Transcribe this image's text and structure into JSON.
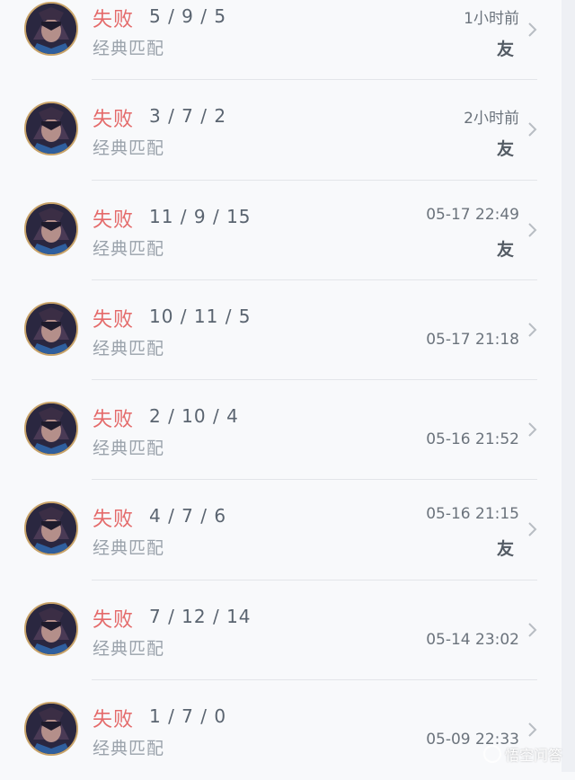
{
  "colors": {
    "loss": "#e46a6a",
    "kda": "#5a6470",
    "mode": "#9aa2ab",
    "time": "#6b737c",
    "friend": "#545c65",
    "avatar_border": "#c9a46a"
  },
  "matches": [
    {
      "result": "失败",
      "kda": "5 / 9 / 5",
      "mode": "经典匹配",
      "time": "1小时前",
      "friend": "友",
      "avatar_icon": "hero-avatar-icon",
      "chevron_icon": "chevron-right-icon"
    },
    {
      "result": "失败",
      "kda": "3 / 7 / 2",
      "mode": "经典匹配",
      "time": "2小时前",
      "friend": "友",
      "avatar_icon": "hero-avatar-icon",
      "chevron_icon": "chevron-right-icon"
    },
    {
      "result": "失败",
      "kda": "11 / 9 / 15",
      "mode": "经典匹配",
      "time": "05-17 22:49",
      "friend": "友",
      "avatar_icon": "hero-avatar-icon",
      "chevron_icon": "chevron-right-icon"
    },
    {
      "result": "失败",
      "kda": "10 / 11 / 5",
      "mode": "经典匹配",
      "time": "05-17 21:18",
      "friend": null,
      "avatar_icon": "hero-avatar-icon",
      "chevron_icon": "chevron-right-icon"
    },
    {
      "result": "失败",
      "kda": "2 / 10 / 4",
      "mode": "经典匹配",
      "time": "05-16 21:52",
      "friend": null,
      "avatar_icon": "hero-avatar-icon",
      "chevron_icon": "chevron-right-icon"
    },
    {
      "result": "失败",
      "kda": "4 / 7 / 6",
      "mode": "经典匹配",
      "time": "05-16 21:15",
      "friend": "友",
      "avatar_icon": "hero-avatar-icon",
      "chevron_icon": "chevron-right-icon"
    },
    {
      "result": "失败",
      "kda": "7 / 12 / 14",
      "mode": "经典匹配",
      "time": "05-14 23:02",
      "friend": null,
      "avatar_icon": "hero-avatar-icon",
      "chevron_icon": "chevron-right-icon"
    },
    {
      "result": "失败",
      "kda": "1 / 7 / 0",
      "mode": "经典匹配",
      "time": "05-09 22:33",
      "friend": null,
      "avatar_icon": "hero-avatar-icon",
      "chevron_icon": "chevron-right-icon"
    }
  ],
  "watermark": {
    "text": "悟空问答",
    "icon": "wukong-logo-icon"
  }
}
